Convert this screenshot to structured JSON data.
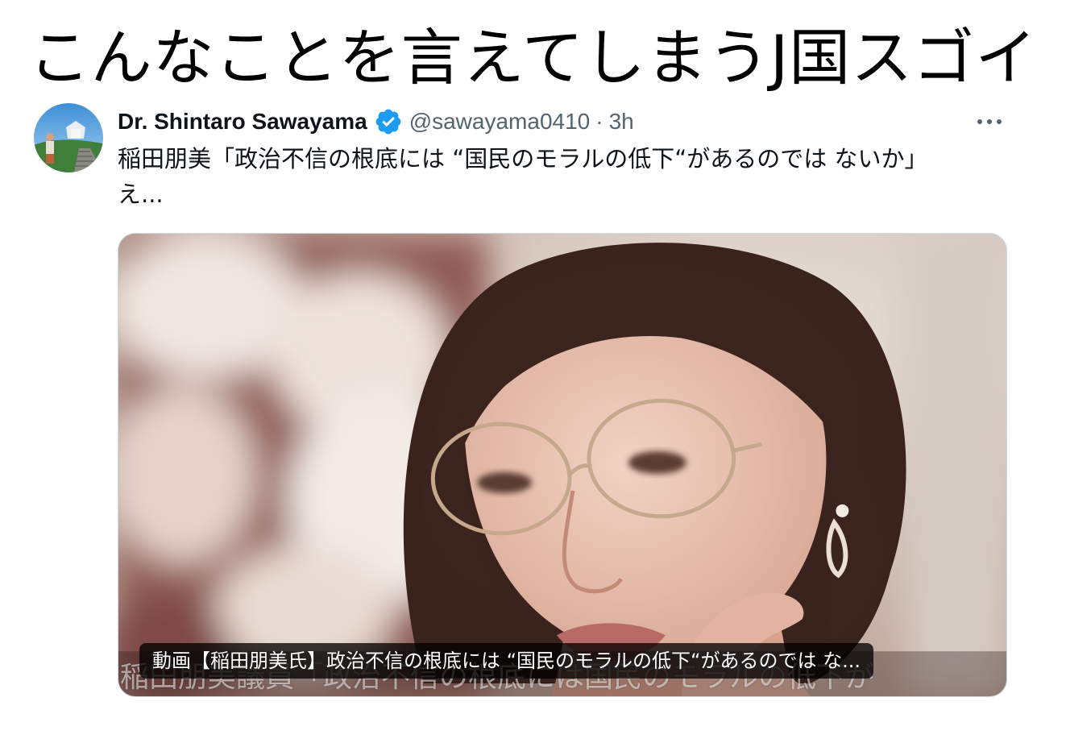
{
  "caption": "こんなことを言えてしまうJ国スゴイ",
  "tweet": {
    "display_name": "Dr. Shintaro Sawayama",
    "verified": true,
    "handle": "@sawayama0410",
    "separator": "·",
    "time": "3h",
    "text_line1": "稲田朋美「政治不信の根底には “国民のモラルの低下“があるのでは ないか」",
    "text_line2": "え..."
  },
  "media": {
    "link_card_title": "動画【稲田朋美氏】政治不信の根底には “国民のモラルの低下“があるのでは な...",
    "burned_subtitle": "稲田朋美議員「政治不信の根底には国民のモラルの低下が"
  },
  "icons": {
    "verified": "verified-badge-icon",
    "more": "more-options-icon"
  },
  "colors": {
    "verified_blue": "#1d9bf0",
    "secondary_text": "#536471",
    "primary_text": "#0f1419"
  }
}
